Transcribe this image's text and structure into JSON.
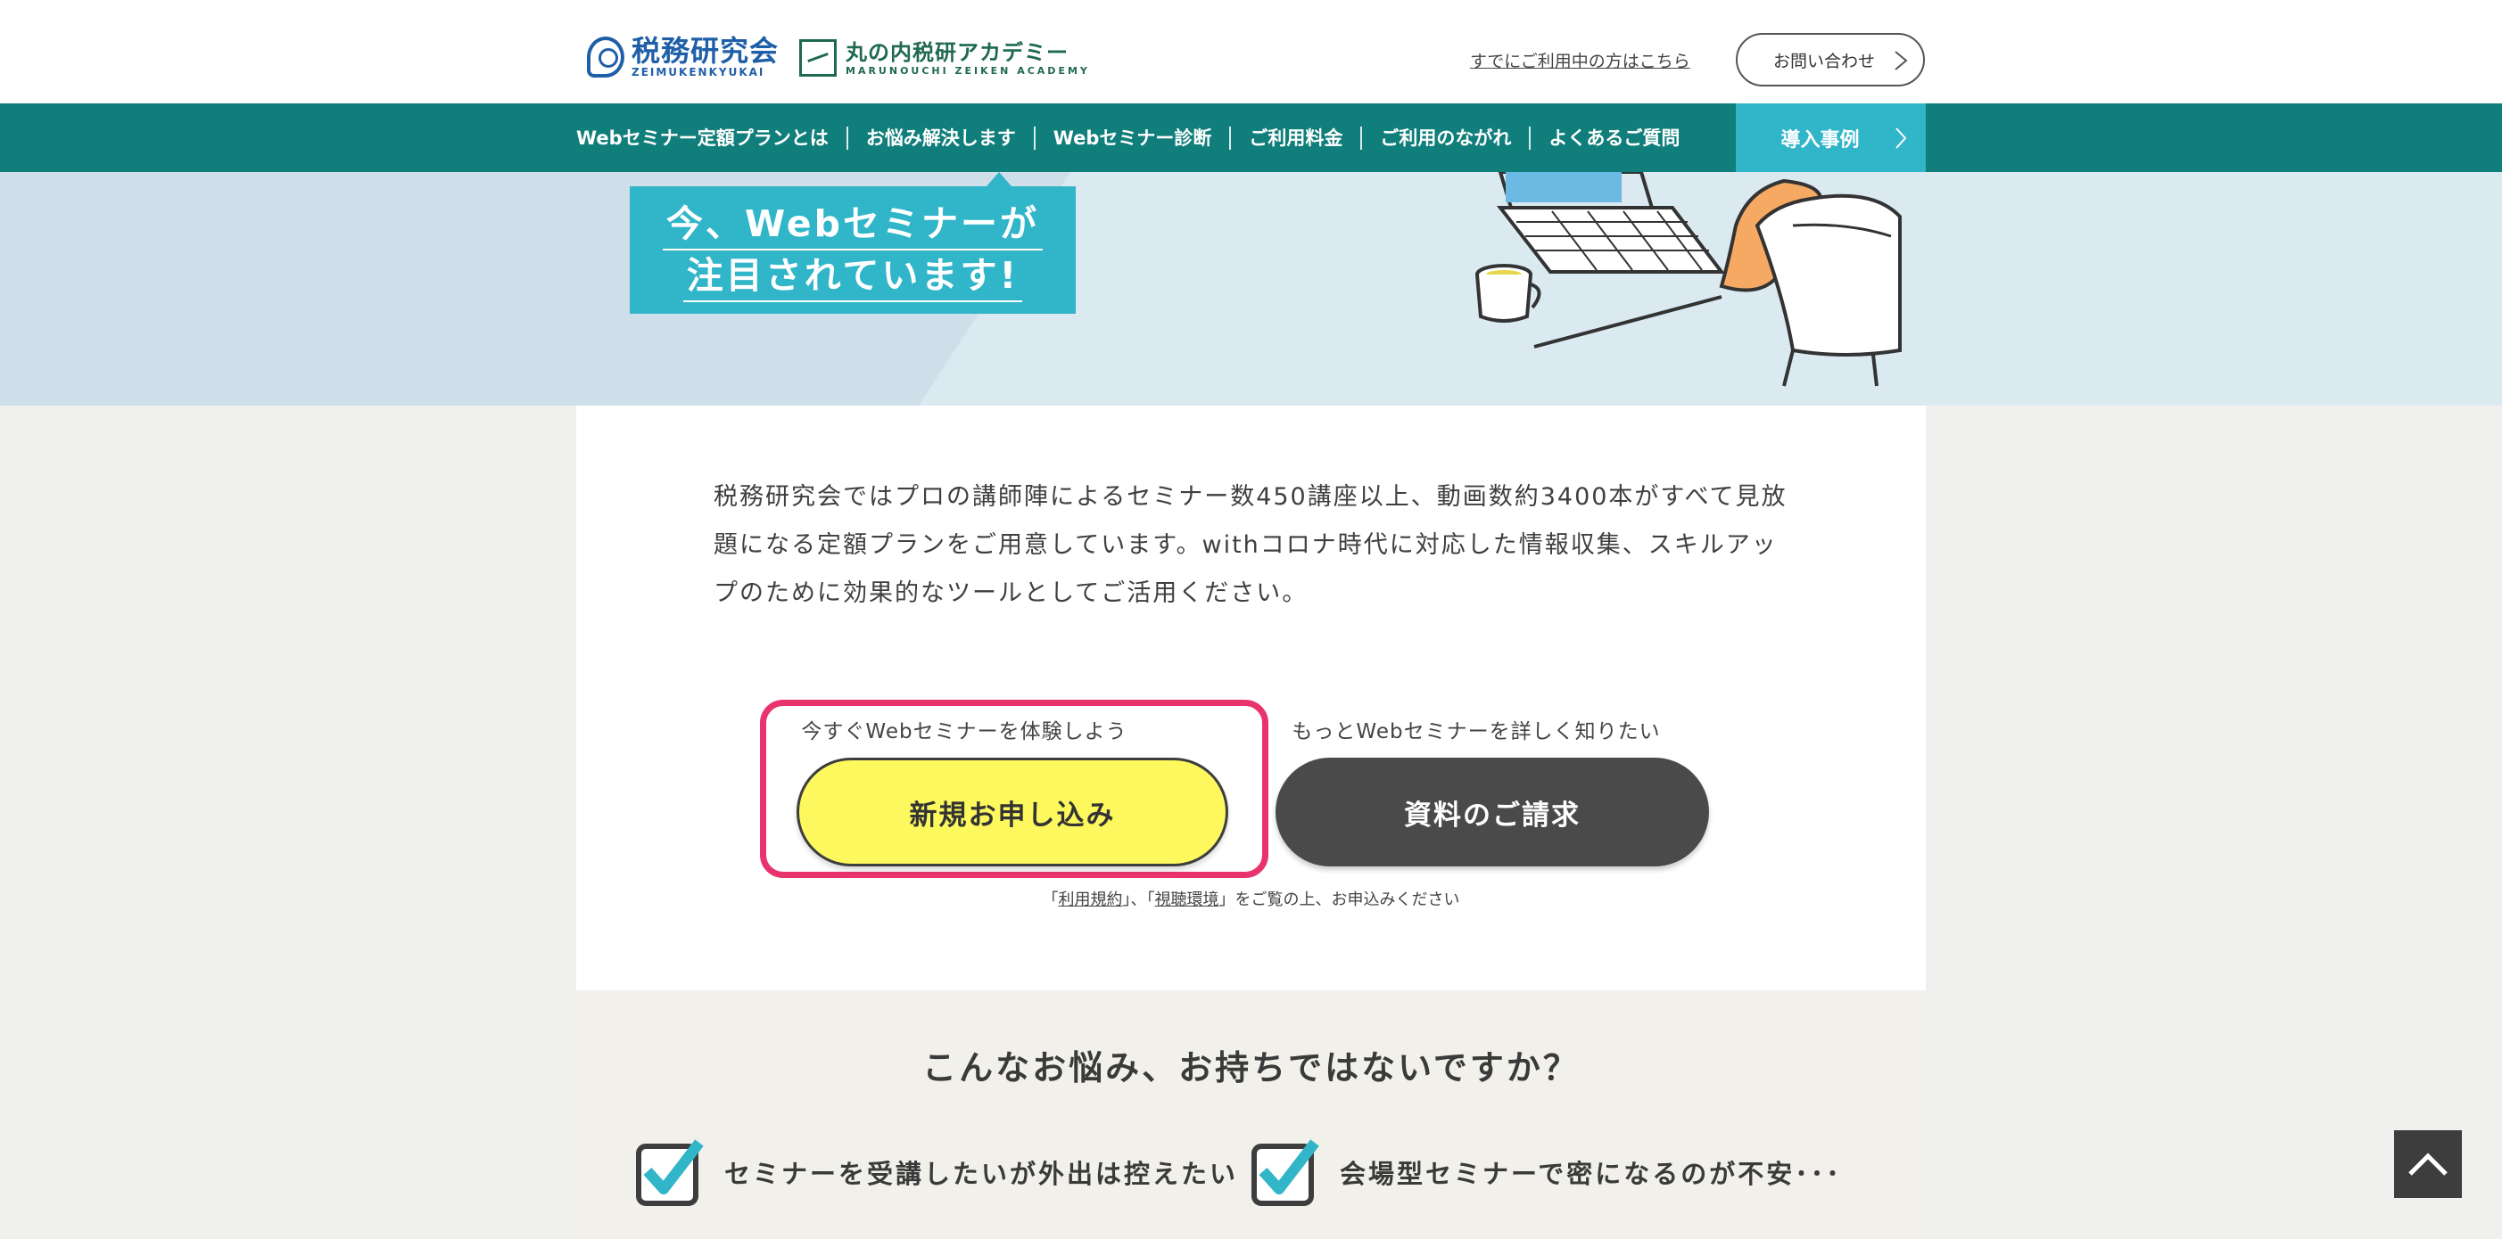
{
  "header": {
    "logo_primary": "税務研究会",
    "logo_primary_sub": "ZEIMUKENKYUKAI",
    "logo_secondary": "丸の内税研アカデミー",
    "logo_secondary_sub": "MARUNOUCHI ZEIKEN ACADEMY",
    "existing_user_link": "すでにご利用中の方はこちら",
    "contact_button": "お問い合わせ"
  },
  "nav": {
    "items": [
      {
        "label": "Webセミナー定額プランとは"
      },
      {
        "label": "お悩み解決します"
      },
      {
        "label": "Webセミナー診断"
      },
      {
        "label": "ご利用料金"
      },
      {
        "label": "ご利用のながれ"
      },
      {
        "label": "よくあるご質問"
      }
    ],
    "case_studies": "導入事例"
  },
  "hero": {
    "line1": "今、Webセミナーが",
    "line2": "注目されています!"
  },
  "intro": {
    "text": "税務研究会ではプロの講師陣によるセミナー数450講座以上、動画数約3400本がすべて見放題になる定額プランをご用意しています。withコロナ時代に対応した情報収集、スキルアップのために効果的なツールとしてご活用ください。"
  },
  "cta": {
    "left_caption": "今すぐWebセミナーを体験しよう",
    "apply_button": "新規お申し込み",
    "right_caption": "もっとWebセミナーを詳しく知りたい",
    "request_button": "資料のご請求",
    "terms_prefix": "「",
    "terms_link": "利用規約",
    "terms_mid": "」、「",
    "env_link": "視聴環境",
    "terms_suffix": "」をご覧の上、お申込みください"
  },
  "concerns": {
    "title": "こんなお悩み、お持ちではないですか？",
    "items": [
      {
        "text": "セミナーを受講したいが外出は控えたい"
      },
      {
        "text": "会場型セミナーで密になるのが不安･･･"
      }
    ]
  },
  "colors": {
    "teal_nav": "#107e7a",
    "cyan_accent": "#31b5c9",
    "highlight": "#e8336d",
    "apply_yellow": "#fcf85e",
    "request_dark": "#4a4a4a"
  },
  "icons": {
    "contact_chevron": "chevron-right-icon",
    "case_chevron": "chevron-right-icon",
    "check": "checkbox-checked-icon",
    "to_top": "chevron-up-icon"
  }
}
